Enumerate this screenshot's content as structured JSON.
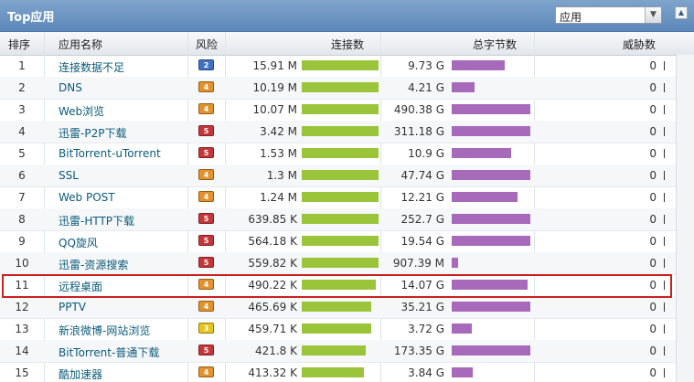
{
  "panel": {
    "title": "Top应用",
    "selector_value": "应用",
    "selector_arrow": "▼",
    "collapse_glyph": "▲"
  },
  "columns": {
    "rank": "排序",
    "app_name": "应用名称",
    "risk": "风险",
    "connections": "连接数",
    "total_bytes": "总字节数",
    "threats": "威胁数"
  },
  "colors": {
    "connection_bar": "#9ac43a",
    "bytes_bar": "#a769ba",
    "risk_2": "#3f73c2",
    "risk_3": "#e6c51e",
    "risk_4": "#e3922c",
    "risk_5": "#c5363a",
    "highlight_border": "#cc1f1f"
  },
  "highlighted_rank": "11",
  "rows": [
    {
      "rank": "1",
      "app": "连接数据不足",
      "risk": "2",
      "connections": "15.91 M",
      "conn_fraction": 1.0,
      "bytes": "9.73 G",
      "bytes_fraction": 0.67,
      "threats": "0"
    },
    {
      "rank": "2",
      "app": "DNS",
      "risk": "4",
      "connections": "10.19 M",
      "conn_fraction": 1.0,
      "bytes": "4.21 G",
      "bytes_fraction": 0.29,
      "threats": "0"
    },
    {
      "rank": "3",
      "app": "Web浏览",
      "risk": "4",
      "connections": "10.07 M",
      "conn_fraction": 1.0,
      "bytes": "490.38 G",
      "bytes_fraction": 1.0,
      "threats": "0"
    },
    {
      "rank": "4",
      "app": "迅雷-P2P下载",
      "risk": "5",
      "connections": "3.42 M",
      "conn_fraction": 1.0,
      "bytes": "311.18 G",
      "bytes_fraction": 1.0,
      "threats": "0"
    },
    {
      "rank": "5",
      "app": "BitTorrent-uTorrent",
      "risk": "5",
      "connections": "1.53 M",
      "conn_fraction": 1.0,
      "bytes": "10.9 G",
      "bytes_fraction": 0.75,
      "threats": "0"
    },
    {
      "rank": "6",
      "app": "SSL",
      "risk": "4",
      "connections": "1.3 M",
      "conn_fraction": 1.0,
      "bytes": "47.74 G",
      "bytes_fraction": 1.0,
      "threats": "0"
    },
    {
      "rank": "7",
      "app": "Web POST",
      "risk": "4",
      "connections": "1.24 M",
      "conn_fraction": 1.0,
      "bytes": "12.21 G",
      "bytes_fraction": 0.84,
      "threats": "0"
    },
    {
      "rank": "8",
      "app": "迅雷-HTTP下载",
      "risk": "5",
      "connections": "639.85 K",
      "conn_fraction": 1.0,
      "bytes": "252.7 G",
      "bytes_fraction": 1.0,
      "threats": "0"
    },
    {
      "rank": "9",
      "app": "QQ旋风",
      "risk": "5",
      "connections": "564.18 K",
      "conn_fraction": 1.0,
      "bytes": "19.54 G",
      "bytes_fraction": 1.0,
      "threats": "0"
    },
    {
      "rank": "10",
      "app": "迅雷-资源搜索",
      "risk": "5",
      "connections": "559.82 K",
      "conn_fraction": 1.0,
      "bytes": "907.39 M",
      "bytes_fraction": 0.08,
      "threats": "0"
    },
    {
      "rank": "11",
      "app": "远程桌面",
      "risk": "4",
      "connections": "490.22 K",
      "conn_fraction": 0.96,
      "bytes": "14.07 G",
      "bytes_fraction": 0.97,
      "threats": "0"
    },
    {
      "rank": "12",
      "app": "PPTV",
      "risk": "4",
      "connections": "465.69 K",
      "conn_fraction": 0.91,
      "bytes": "35.21 G",
      "bytes_fraction": 1.0,
      "threats": "0"
    },
    {
      "rank": "13",
      "app": "新浪微博-网站浏览",
      "risk": "3",
      "connections": "459.71 K",
      "conn_fraction": 0.9,
      "bytes": "3.72 G",
      "bytes_fraction": 0.26,
      "threats": "0"
    },
    {
      "rank": "14",
      "app": "BitTorrent-普通下载",
      "risk": "5",
      "connections": "421.8 K",
      "conn_fraction": 0.83,
      "bytes": "173.35 G",
      "bytes_fraction": 1.0,
      "threats": "0"
    },
    {
      "rank": "15",
      "app": "酷加速器",
      "risk": "4",
      "connections": "413.32 K",
      "conn_fraction": 0.81,
      "bytes": "3.84 G",
      "bytes_fraction": 0.27,
      "threats": "0"
    }
  ]
}
